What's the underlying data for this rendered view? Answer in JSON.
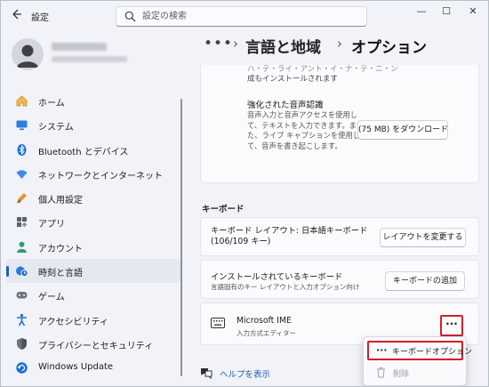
{
  "window": {
    "title": "設定",
    "controls": {
      "minimize": "—",
      "maximize": "☐",
      "close": "✕"
    }
  },
  "search": {
    "placeholder": "設定の検索"
  },
  "sidebar": {
    "items": [
      {
        "label": "ホーム",
        "icon": "home-icon",
        "active": false
      },
      {
        "label": "システム",
        "icon": "system-icon",
        "active": false
      },
      {
        "label": "Bluetooth とデバイス",
        "icon": "bluetooth-icon",
        "active": false
      },
      {
        "label": "ネットワークとインターネット",
        "icon": "wifi-icon",
        "active": false
      },
      {
        "label": "個人用設定",
        "icon": "brush-icon",
        "active": false
      },
      {
        "label": "アプリ",
        "icon": "apps-icon",
        "active": false
      },
      {
        "label": "アカウント",
        "icon": "account-icon",
        "active": false
      },
      {
        "label": "時刻と言語",
        "icon": "time-language-icon",
        "active": true
      },
      {
        "label": "ゲーム",
        "icon": "gamepad-icon",
        "active": false
      },
      {
        "label": "アクセシビリティ",
        "icon": "accessibility-icon",
        "active": false
      },
      {
        "label": "プライバシーとセキュリティ",
        "icon": "shield-icon",
        "active": false
      },
      {
        "label": "Windows Update",
        "icon": "update-icon",
        "active": false
      }
    ]
  },
  "breadcrumb": {
    "more": "•••",
    "separator": "›",
    "items": [
      "言語と地域",
      "オプション"
    ]
  },
  "speech": {
    "top_text_line1": "ハ・テ・ライ・アント・イ・ナ・テ・ニ・ン",
    "top_text_line2": "成もインストールされます",
    "title": "強化された音声認識",
    "description": "音声入力と音声アクセスを使用して、テキストを入力できます。また、ライブ キャプションを使用して、音声を書き起こします。",
    "download_button": "(75 MB) をダウンロード"
  },
  "keyboard": {
    "section_title": "キーボード",
    "layout": {
      "title": "キーボード レイアウト: 日本語キーボード (106/109 キー)",
      "button": "レイアウトを変更する"
    },
    "installed": {
      "title": "インストールされているキーボード",
      "subtitle": "言語固有のキー レイアウトと入力オプション向け",
      "button": "キーボードの追加"
    },
    "ime": {
      "title": "Microsoft IME",
      "subtitle": "入力方式エディター",
      "more_button": "···"
    }
  },
  "help": {
    "label": "ヘルプを表示"
  },
  "context_menu": {
    "options_label": "キーボードオプション",
    "options_dots": "···",
    "delete_label": "削除"
  },
  "colors": {
    "accent": "#1f5fb8",
    "highlight_red": "#d0202a",
    "link": "#1a5fb4"
  }
}
